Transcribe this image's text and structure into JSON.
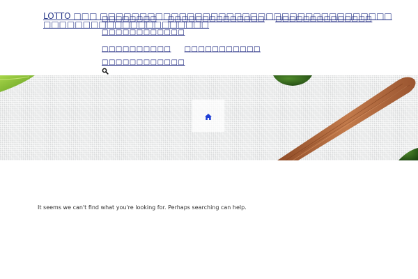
{
  "header": {
    "site_title": "LOTTO □□□ □□□□□□□□□□□□□□□□□□□□□□□□□□□□□□□□□□□□□□□□□□□□□□□□□□□□□□□□□□",
    "primary_nav": [
      {
        "label": "□□□□□□□□"
      },
      {
        "label": "□□□□□□□□□□□□□□"
      },
      {
        "label": "□□□□□□□□□□□□□□"
      },
      {
        "label": "□□□□□□□□□□□□"
      }
    ],
    "secondary_nav": [
      {
        "label": "□□□□□□□□□□"
      },
      {
        "label": "□□□□□□□□□□□"
      },
      {
        "label": "□□□□□□□□□□□□"
      }
    ],
    "search_icon": "search-icon"
  },
  "hero": {
    "home_icon": "home-icon",
    "colors": {
      "linen": "#eceded",
      "wood": "#b46a3e",
      "leaf": "#7fb832",
      "home_icon": "#1f3fd6"
    }
  },
  "content": {
    "message": "It seems we can't find what you're looking for. Perhaps searching can help."
  }
}
